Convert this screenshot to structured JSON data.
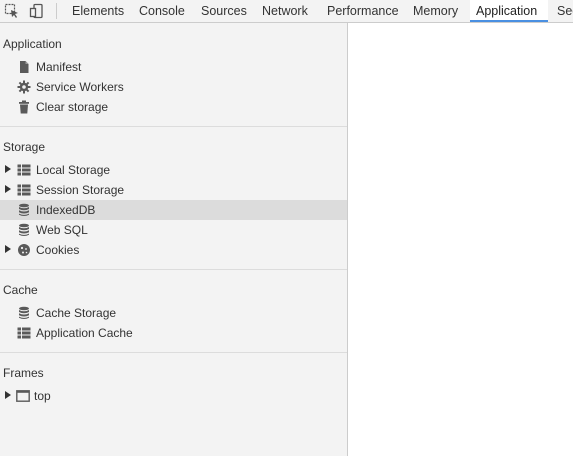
{
  "toolbar": {
    "tabs": [
      "Elements",
      "Console",
      "Sources",
      "Network",
      "Performance",
      "Memory",
      "Application",
      "Sec"
    ],
    "active_tab": "Application"
  },
  "sidebar": {
    "application": {
      "title": "Application",
      "items": [
        "Manifest",
        "Service Workers",
        "Clear storage"
      ]
    },
    "storage": {
      "title": "Storage",
      "items": [
        "Local Storage",
        "Session Storage",
        "IndexedDB",
        "Web SQL",
        "Cookies"
      ],
      "selected": "IndexedDB"
    },
    "cache": {
      "title": "Cache",
      "items": [
        "Cache Storage",
        "Application Cache"
      ]
    },
    "frames": {
      "title": "Frames",
      "items": [
        "top"
      ]
    }
  },
  "colors": {
    "accent": "#4a90e2",
    "sidebar_bg": "#f3f3f3",
    "selected_bg": "#dcdcdc"
  }
}
